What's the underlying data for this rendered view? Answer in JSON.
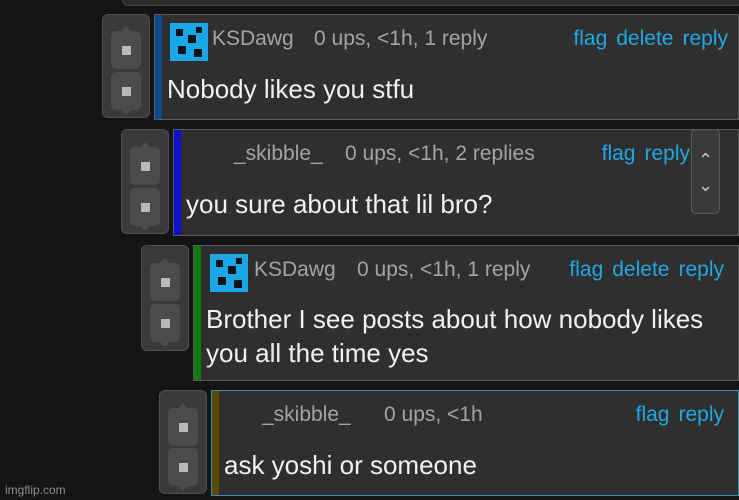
{
  "comments": [
    {
      "username": "KSDawg",
      "stats": "0 ups, <1h, 1 reply",
      "actions": [
        "flag",
        "delete",
        "reply"
      ],
      "text": "Nobody likes you stfu",
      "stripe_color": "#0b4a86",
      "has_avatar": true
    },
    {
      "username": "_skibble_",
      "stats": "0 ups, <1h, 2 replies",
      "actions": [
        "flag",
        "reply"
      ],
      "text": "you sure about that lil bro?",
      "stripe_color": "#1010d0",
      "has_avatar": false
    },
    {
      "username": "KSDawg",
      "stats": "0 ups, <1h, 1 reply",
      "actions": [
        "flag",
        "delete",
        "reply"
      ],
      "text": "Brother I see posts about how nobody likes you all the time yes",
      "stripe_color": "#0f7a10",
      "has_avatar": true
    },
    {
      "username": "_skibble_",
      "stats": "0 ups, <1h",
      "actions": [
        "flag",
        "reply"
      ],
      "text": "ask yoshi or someone",
      "stripe_color": "#5a4a00",
      "has_avatar": false
    }
  ],
  "colors": {
    "background": "#141414",
    "link": "#21a7e3",
    "avatar": "#1aa7e8"
  },
  "watermark": "imgflip.com"
}
